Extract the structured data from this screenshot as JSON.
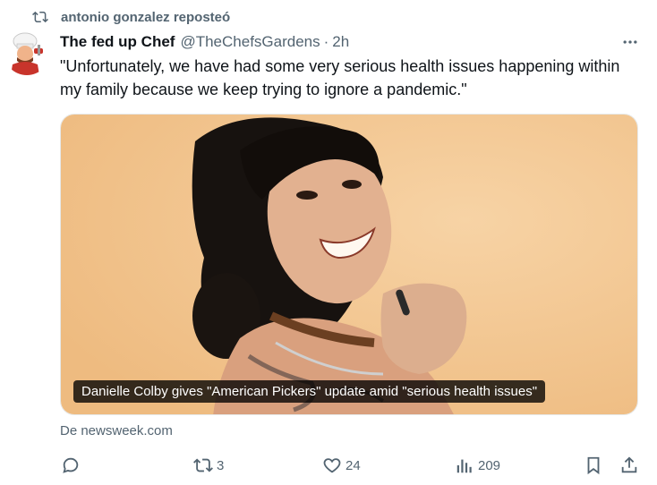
{
  "repost": {
    "text": "antonio gonzalez reposteó",
    "icon": "repost-icon"
  },
  "tweet": {
    "author_name": "The fed up Chef",
    "handle": "@TheChefsGardens",
    "separator": "·",
    "time": "2h",
    "text": "\"Unfortunately, we have had some very serious health issues happening within my family because we keep trying to ignore a pandemic.\"",
    "media_caption": "Danielle Colby gives \"American Pickers\" update amid \"serious health issues\"",
    "source": "De newsweek.com"
  },
  "actions": {
    "reply_count": "",
    "repost_count": "3",
    "like_count": "24",
    "views_count": "209"
  },
  "colors": {
    "text": "#0f1419",
    "muted": "#536471",
    "photo_bg": "#f2c58e"
  }
}
